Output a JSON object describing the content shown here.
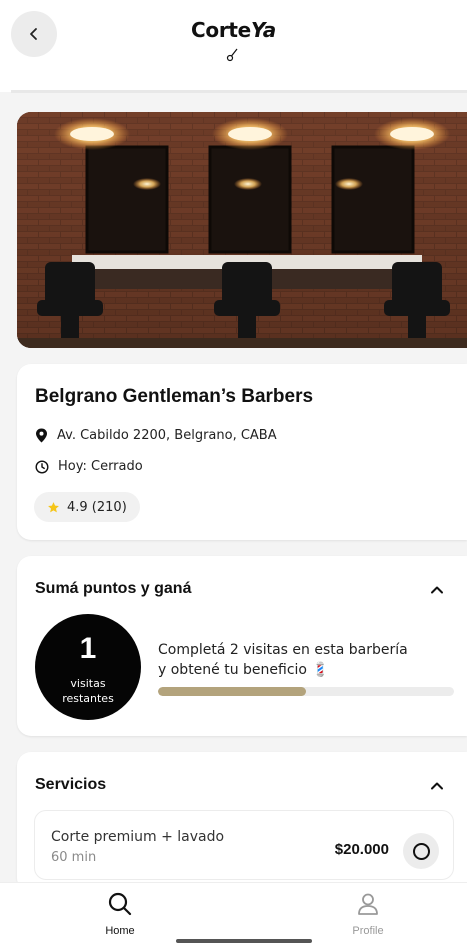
{
  "header": {
    "logo_text_left": "Corte",
    "logo_text_right": "Ya",
    "back_icon": "chevron-left-icon"
  },
  "shop": {
    "name": "Belgrano Gentleman’s Barbers",
    "address": "Av. Cabildo 2200, Belgrano, CABA",
    "hours": "Hoy: Cerrado",
    "rating": "4.9 (210)",
    "star_color": "#f5c518"
  },
  "points": {
    "title": "Sumá puntos y ganá",
    "visits_remaining": "1",
    "visits_label_1": "visitas",
    "visits_label_2": "restantes",
    "text_line1": "Completá 2 visitas en esta barbería",
    "text_line2": "y obtené tu beneficio 💈",
    "progress_fraction": 0.5,
    "progress_color": "#b3a37c"
  },
  "services": {
    "title": "Servicios",
    "items": [
      {
        "name": "Corte premium + lavado",
        "duration": "60 min",
        "price": "$20.000"
      }
    ]
  },
  "nav": {
    "home_label": "Home",
    "profile_label": "Profile"
  }
}
